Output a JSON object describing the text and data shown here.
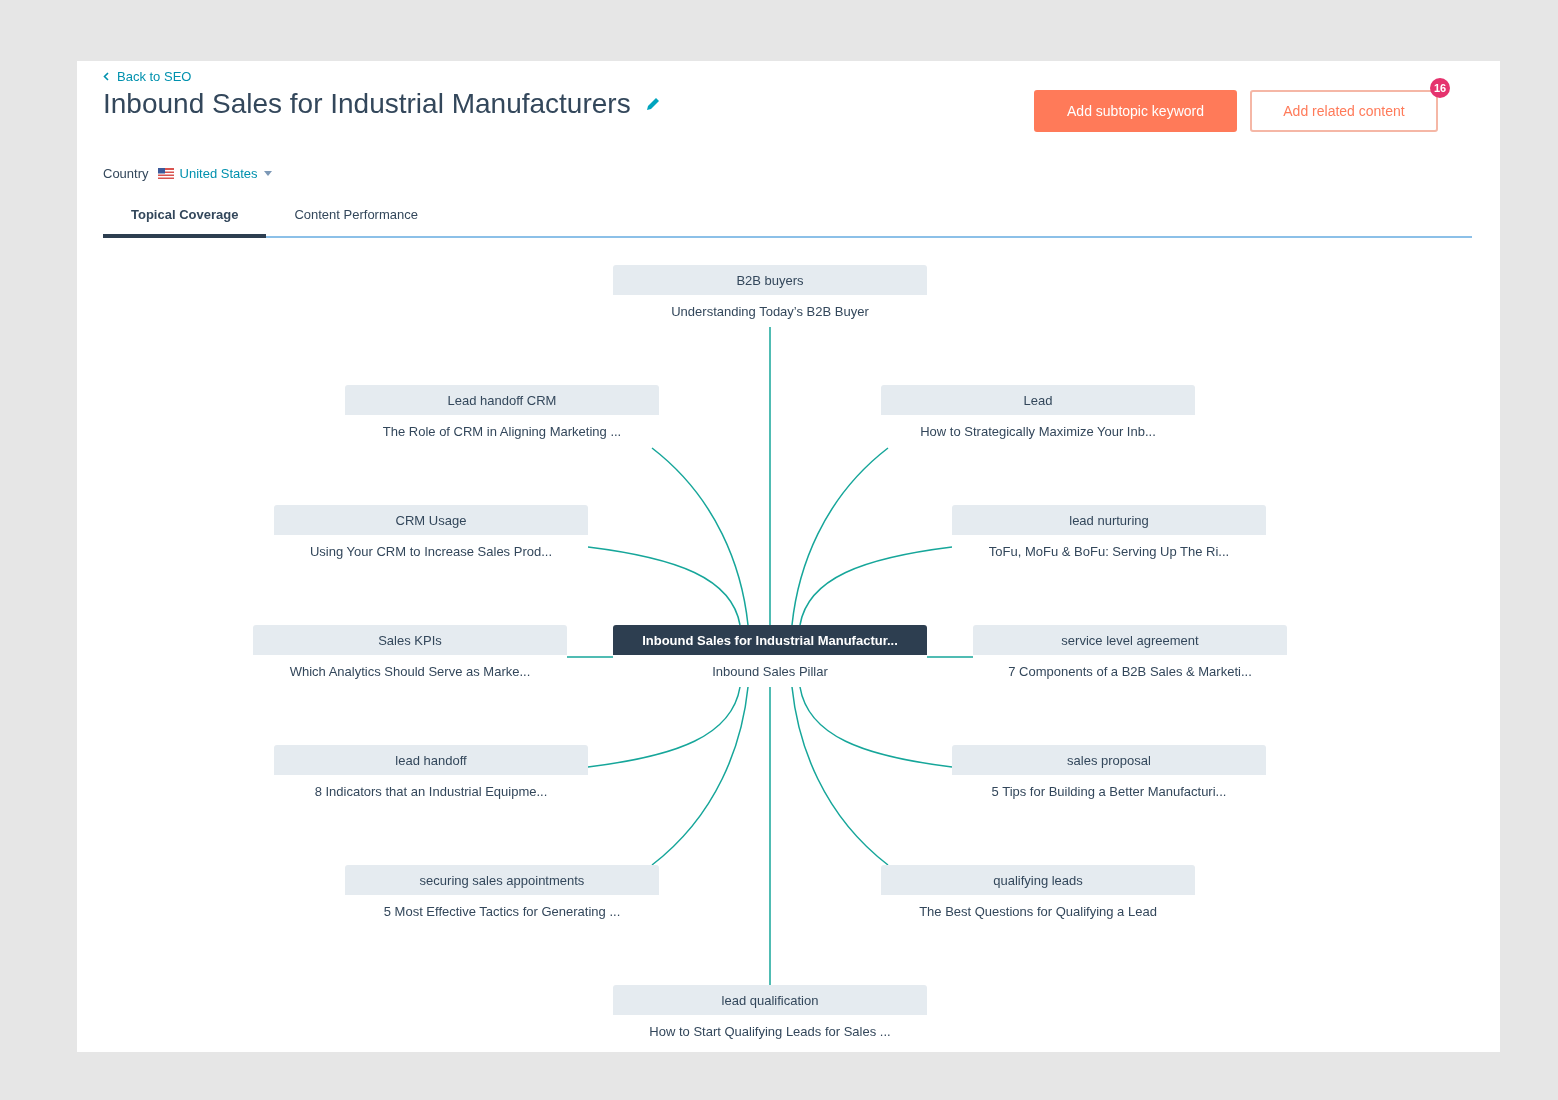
{
  "back_link": "Back to SEO",
  "title": "Inbound Sales for Industrial Manufacturers",
  "buttons": [
    {
      "label": "Add subtopic keyword",
      "kind": "primary"
    },
    {
      "label": "Add related content",
      "kind": "secondary",
      "badge": "16"
    }
  ],
  "country": {
    "label": "Country",
    "value": "United States"
  },
  "tabs": [
    {
      "label": "Topical Coverage",
      "selected": true
    },
    {
      "label": "Content Performance",
      "selected": false
    }
  ],
  "nodes": [
    {
      "kind": "subtopic",
      "keyword": "B2B buyers",
      "content": "Understanding Today’s B2B Buyer"
    },
    {
      "kind": "subtopic",
      "keyword": "Lead handoff CRM",
      "content": "The Role of CRM in Aligning Marketing ..."
    },
    {
      "kind": "subtopic",
      "keyword": "Lead",
      "content": "How to Strategically Maximize Your Inb..."
    },
    {
      "kind": "subtopic",
      "keyword": "CRM Usage",
      "content": "Using Your CRM to Increase Sales Prod..."
    },
    {
      "kind": "subtopic",
      "keyword": "lead nurturing",
      "content": "ToFu, MoFu & BoFu: Serving Up The Ri..."
    },
    {
      "kind": "subtopic",
      "keyword": "Sales KPIs",
      "content": "Which Analytics Should Serve as Marke..."
    },
    {
      "kind": "pillar",
      "keyword": "Inbound Sales for Industrial Manufactur...",
      "content": "Inbound Sales Pillar"
    },
    {
      "kind": "subtopic",
      "keyword": "service level agreement",
      "content": "7 Components of a B2B Sales & Marketi..."
    },
    {
      "kind": "subtopic",
      "keyword": "lead handoff",
      "content": "8 Indicators that an Industrial Equipme..."
    },
    {
      "kind": "subtopic",
      "keyword": "sales proposal",
      "content": "5 Tips for Building a Better Manufacturi..."
    },
    {
      "kind": "subtopic",
      "keyword": "securing sales appointments",
      "content": "5 Most Effective Tactics for Generating ..."
    },
    {
      "kind": "subtopic",
      "keyword": "qualifying leads",
      "content": "The Best Questions for Qualifying a Lead"
    },
    {
      "kind": "subtopic",
      "keyword": "lead qualification",
      "content": "How to Start Qualifying Leads for Sales ..."
    }
  ]
}
